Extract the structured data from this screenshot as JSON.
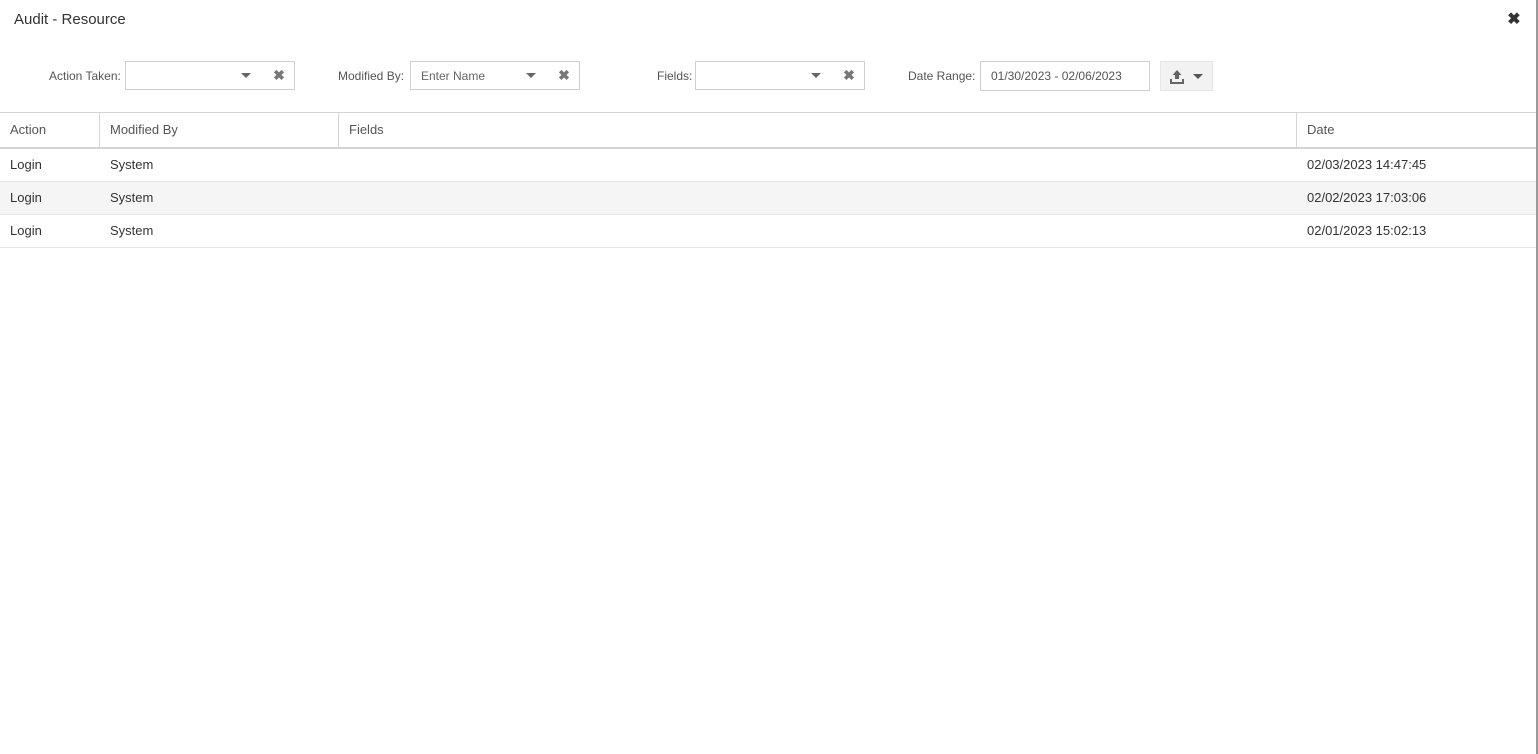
{
  "dialog": {
    "title": "Audit - Resource",
    "close_glyph": "✖"
  },
  "filters": {
    "action_taken": {
      "label": "Action Taken:",
      "value": "",
      "clear_glyph": "✖"
    },
    "modified_by": {
      "label": "Modified By:",
      "placeholder": "Enter Name",
      "clear_glyph": "✖"
    },
    "fields": {
      "label": "Fields:",
      "value": "",
      "clear_glyph": "✖"
    },
    "date_range": {
      "label": "Date Range:",
      "value": "01/30/2023 - 02/06/2023"
    },
    "export": {
      "icon": "upload-icon"
    }
  },
  "table": {
    "columns": [
      "Action",
      "Modified By",
      "Fields",
      "Date"
    ],
    "rows": [
      {
        "action": "Login",
        "modified_by": "System",
        "fields": "",
        "date": "02/03/2023 14:47:45"
      },
      {
        "action": "Login",
        "modified_by": "System",
        "fields": "",
        "date": "02/02/2023 17:03:06"
      },
      {
        "action": "Login",
        "modified_by": "System",
        "fields": "",
        "date": "02/01/2023 15:02:13"
      }
    ]
  },
  "colors": {
    "row_alt": "#f5f5f5",
    "border": "#d4d4d4",
    "text": "#333333"
  }
}
